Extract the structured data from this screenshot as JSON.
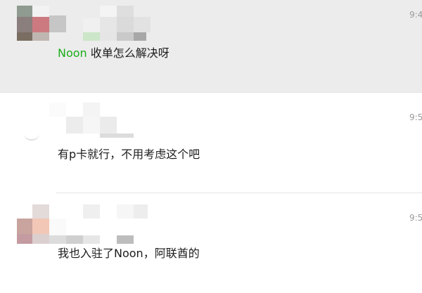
{
  "messages": [
    {
      "time": "9:4",
      "mention": "Noon",
      "text": " 收单怎么解决呀"
    },
    {
      "time": "9:5",
      "text": "有p卡就行，不用考虑这个吧"
    },
    {
      "time": "9:5",
      "text": "我也入驻了Noon，阿联酋的"
    }
  ],
  "colors": {
    "selected_row_bg": "#ececec",
    "mention_color": "#1aad19",
    "time_color": "#9a9a9a"
  }
}
